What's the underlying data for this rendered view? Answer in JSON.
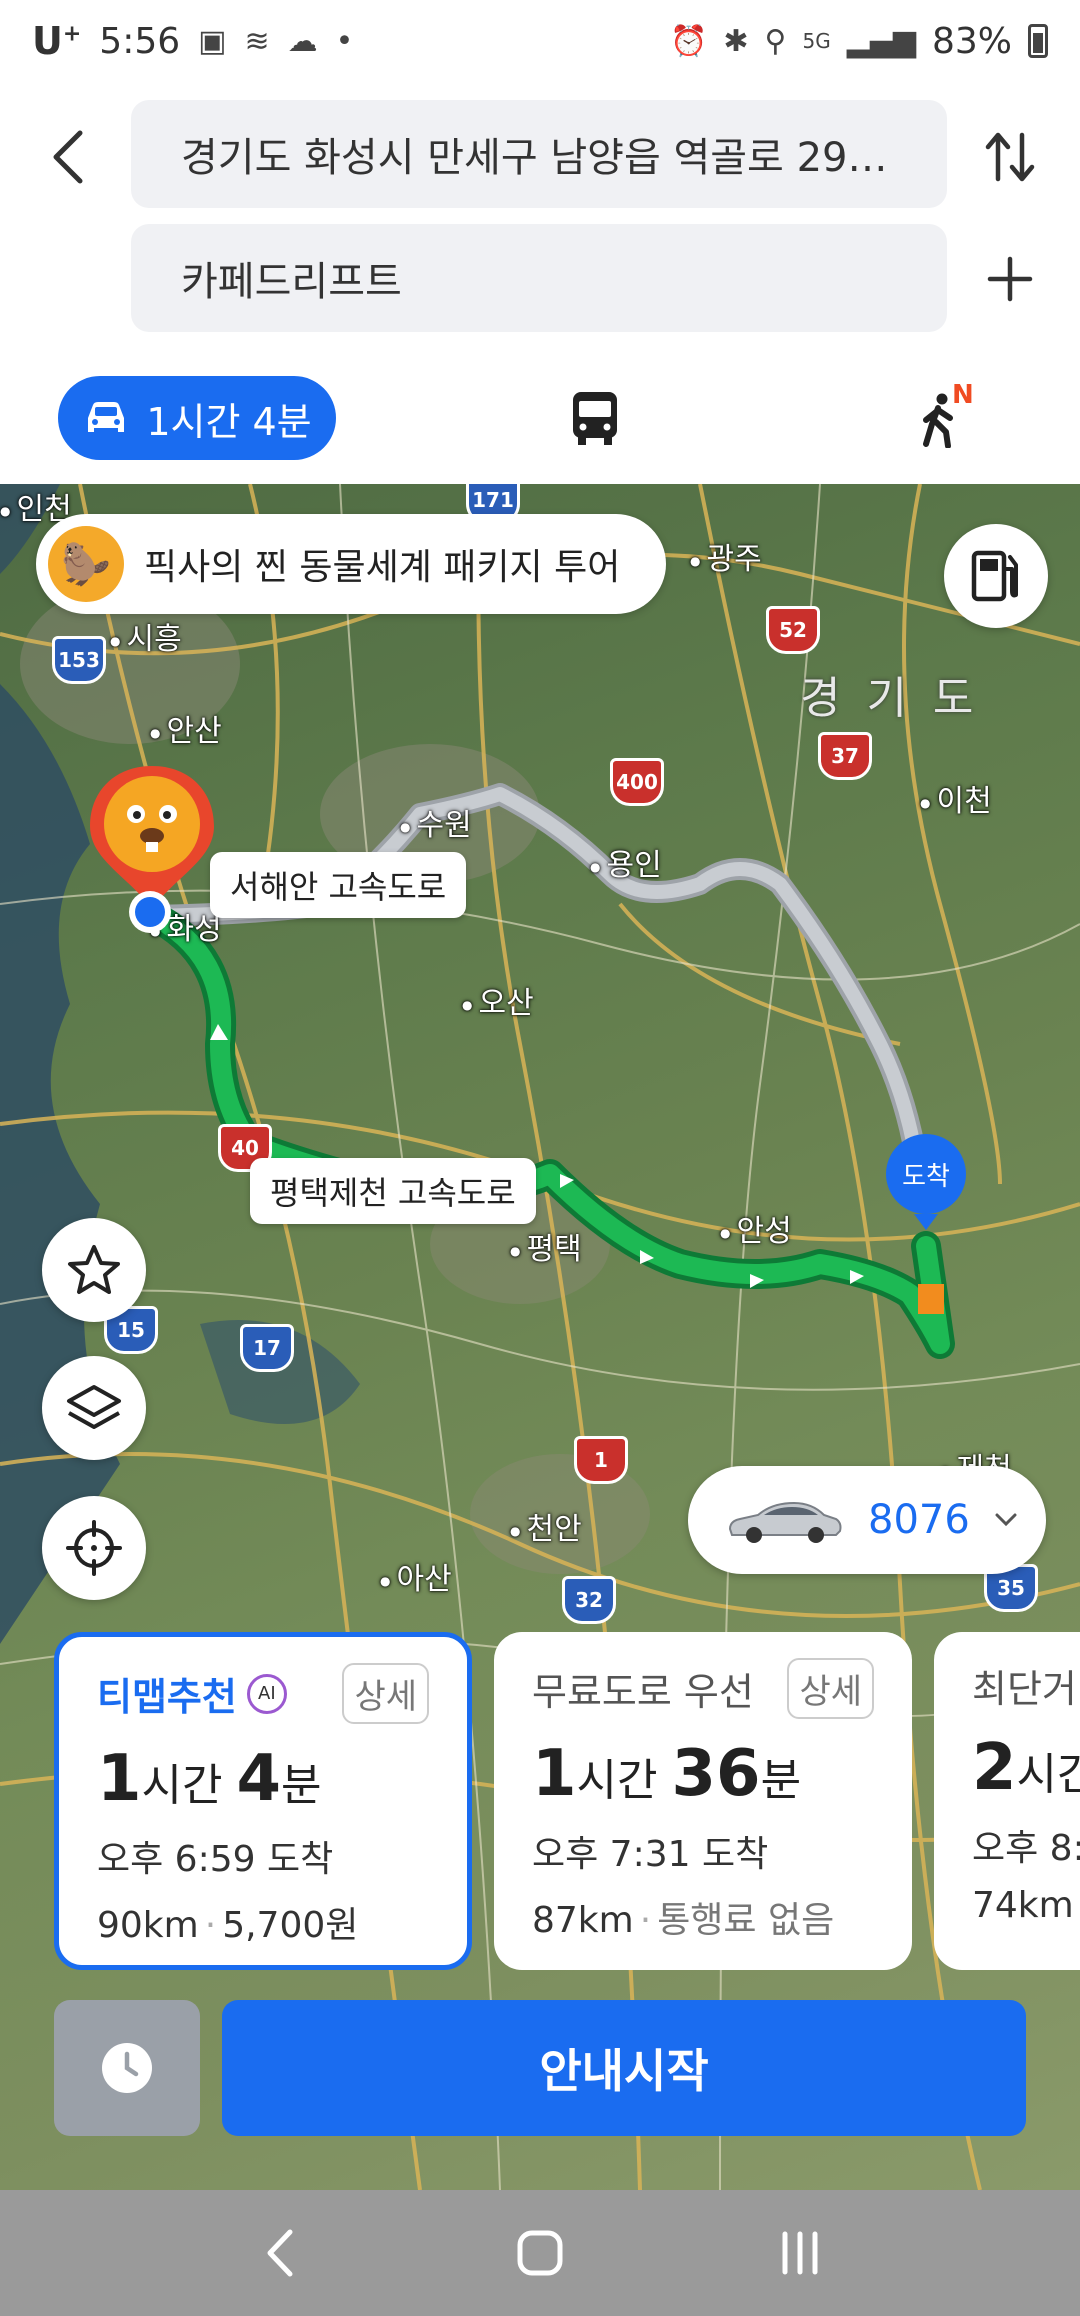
{
  "status_bar": {
    "carrier": "U",
    "carrier_sup": "+",
    "time": "5:56",
    "network": "5G",
    "battery": "83%"
  },
  "search": {
    "origin": "경기도 화성시 만세구 남양읍 역골로 29…",
    "destination": "카페드리프트"
  },
  "modes": {
    "car_label": "1시간 4분",
    "walk_badge": "N"
  },
  "map": {
    "promo_text": "픽사의 찐 동물세계 패키지 투어",
    "region_label": "경 기 도",
    "cities": [
      "인천",
      "시흥",
      "안산",
      "수원",
      "용인",
      "화성",
      "오산",
      "평택",
      "안성",
      "천안",
      "아산",
      "광주",
      "이천",
      "제천"
    ],
    "road_labels": {
      "west_coast": "서해안 고속도로",
      "pyeongtaek_jecheon": "평택제천 고속도로"
    },
    "highway_shields": [
      "171",
      "52",
      "153",
      "400",
      "37",
      "40",
      "15",
      "17",
      "1",
      "32",
      "35"
    ],
    "arrival_label": "도착",
    "vehicle_number": "8076"
  },
  "routes": [
    {
      "title": "티맵추천",
      "ai_badge": "AI",
      "detail": "상세",
      "hours": "1",
      "hours_unit": "시간",
      "minutes": "4",
      "minutes_unit": "분",
      "arrival": "오후 6:59 도착",
      "distance": "90km",
      "toll": "5,700원"
    },
    {
      "title": "무료도로 우선",
      "detail": "상세",
      "hours": "1",
      "hours_unit": "시간",
      "minutes": "36",
      "minutes_unit": "분",
      "arrival": "오후 7:31 도착",
      "distance": "87km",
      "toll": "통행료 없음"
    },
    {
      "title": "최단거",
      "hours": "2",
      "hours_unit": "시간",
      "arrival": "오후 8:",
      "distance": "74km"
    }
  ],
  "actions": {
    "start_label": "안내시작"
  },
  "colors": {
    "accent": "#1a6cf0",
    "route_green": "#1db954",
    "alt_route_gray": "#b8bcc2"
  }
}
